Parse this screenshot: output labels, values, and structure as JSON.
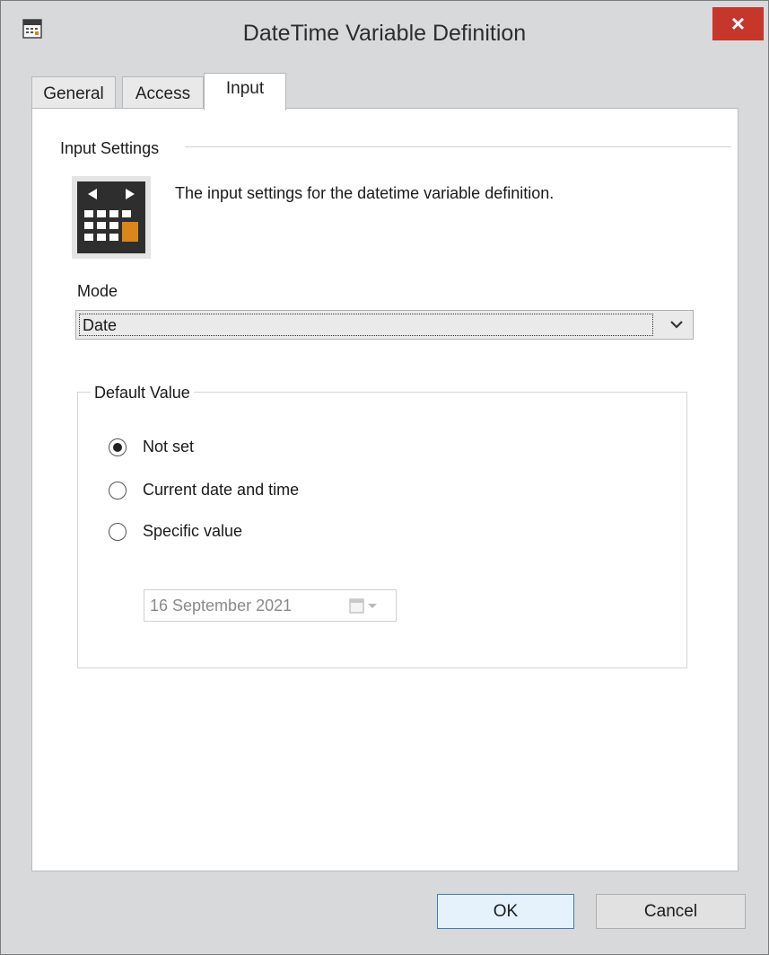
{
  "window": {
    "title": "DateTime Variable Definition",
    "close_label": "×"
  },
  "tabs": [
    {
      "label": "General",
      "active": false
    },
    {
      "label": "Access",
      "active": false
    },
    {
      "label": "Input",
      "active": true
    }
  ],
  "input_settings": {
    "section_title": "Input Settings",
    "description": "The input settings for the datetime variable definition.",
    "icon": "calendar-icon"
  },
  "mode": {
    "label": "Mode",
    "selected": "Date"
  },
  "default_value": {
    "legend": "Default Value",
    "options": [
      {
        "label": "Not set",
        "checked": true
      },
      {
        "label": "Current date and time",
        "checked": false
      },
      {
        "label": "Specific value",
        "checked": false
      }
    ],
    "specific_date": "16 September 2021"
  },
  "buttons": {
    "ok": "OK",
    "cancel": "Cancel"
  },
  "colors": {
    "accent_ok_border": "#3c7fb1",
    "close_button": "#c7362b",
    "calendar_accent": "#d9861a"
  }
}
